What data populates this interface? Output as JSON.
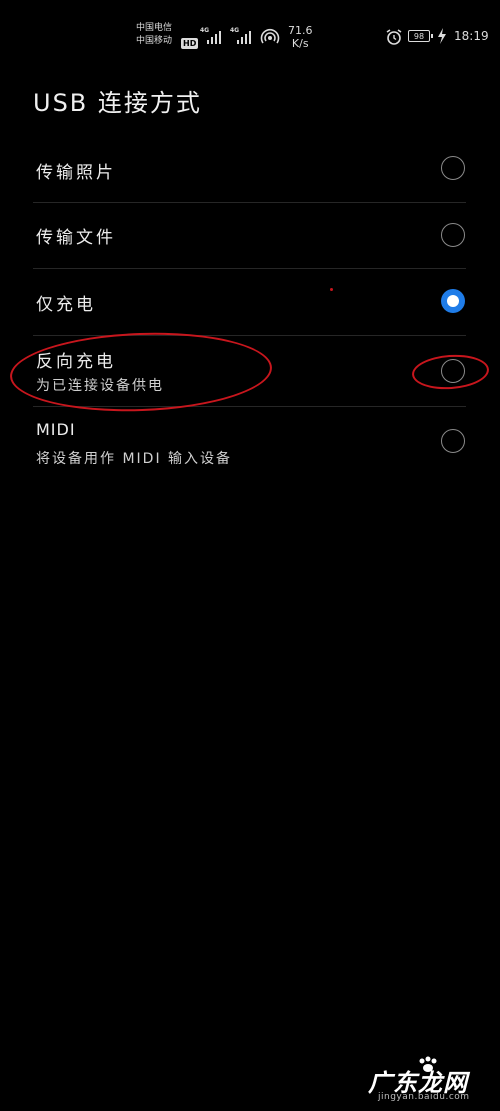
{
  "status_bar": {
    "carrier_1": "中国电信",
    "carrier_2": "中国移动",
    "hd_badge": "HD",
    "network_1": "4G",
    "network_2": "4G",
    "speed_value": "71.6",
    "speed_unit": "K/s",
    "battery_level": "98",
    "time": "18:19",
    "icons": [
      "signal-icon",
      "signal-icon",
      "hotspot-icon",
      "alarm-icon",
      "battery-icon",
      "charging-icon"
    ]
  },
  "page": {
    "title": "USB 连接方式"
  },
  "options": [
    {
      "label": "传输照片",
      "sublabel": "",
      "selected": false
    },
    {
      "label": "传输文件",
      "sublabel": "",
      "selected": false
    },
    {
      "label": "仅充电",
      "sublabel": "",
      "selected": true
    },
    {
      "label": "反向充电",
      "sublabel": "为已连接设备供电",
      "selected": false
    },
    {
      "label": "MIDI",
      "sublabel": "将设备用作 MIDI 输入设备",
      "selected": false
    }
  ],
  "colors": {
    "background": "#000000",
    "accent": "#1f7ce8",
    "annotation": "#c8161d",
    "text": "#ececec"
  },
  "watermark": {
    "title": "广东龙网",
    "url": "jingyan.baidu.com"
  }
}
